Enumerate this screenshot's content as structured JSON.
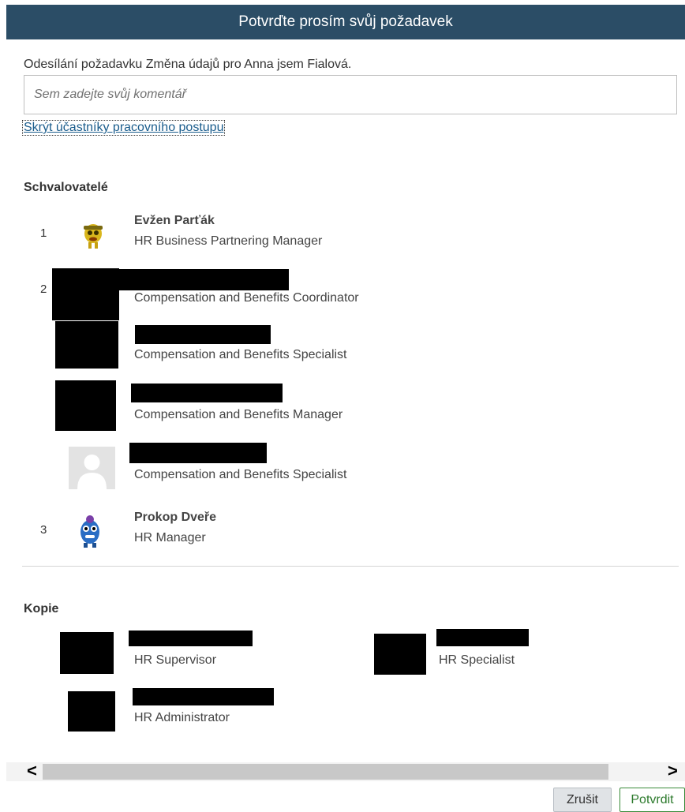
{
  "dialog": {
    "title": "Potvrďte prosím svůj požadavek",
    "sending_text": "Odesílání požadavku Změna údajů pro Anna jsem Fialová.",
    "comment_placeholder": "Sem zadejte svůj komentář",
    "hide_participants_link": "Skrýt účastníky pracovního postupu"
  },
  "approvers": {
    "title": "Schvalovatelé",
    "steps": [
      {
        "number": "1",
        "people": [
          {
            "name": "Evžen Parťák",
            "role": "HR Business Partnering Manager",
            "avatar": "yellow-monster-icon"
          }
        ]
      },
      {
        "number": "2",
        "people": [
          {
            "name": "",
            "role": "Compensation and Benefits Coordinator",
            "avatar": "redacted"
          },
          {
            "name": "",
            "role": "Compensation and Benefits Specialist",
            "avatar": "redacted"
          },
          {
            "name": "",
            "role": "Compensation and Benefits Manager",
            "avatar": "redacted"
          },
          {
            "name": "",
            "role": "Compensation and Benefits Specialist",
            "avatar": "default-user-icon"
          }
        ]
      },
      {
        "number": "3",
        "people": [
          {
            "name": "Prokop Dveře",
            "role": "HR Manager",
            "avatar": "blue-monster-icon"
          }
        ]
      }
    ]
  },
  "copies": {
    "title": "Kopie",
    "people": [
      {
        "name": "",
        "role": "HR Supervisor"
      },
      {
        "name": "",
        "role": "HR Specialist"
      },
      {
        "name": "",
        "role": "HR Administrator"
      }
    ]
  },
  "footer": {
    "cancel_label": "Zrušit",
    "confirm_label": "Potvrdit"
  },
  "scrollbar": {
    "left_arrow": "<",
    "right_arrow": ">"
  },
  "colors": {
    "header_bg": "#2b4d66",
    "link": "#1a5c8c",
    "confirm": "#2c7a2c"
  }
}
